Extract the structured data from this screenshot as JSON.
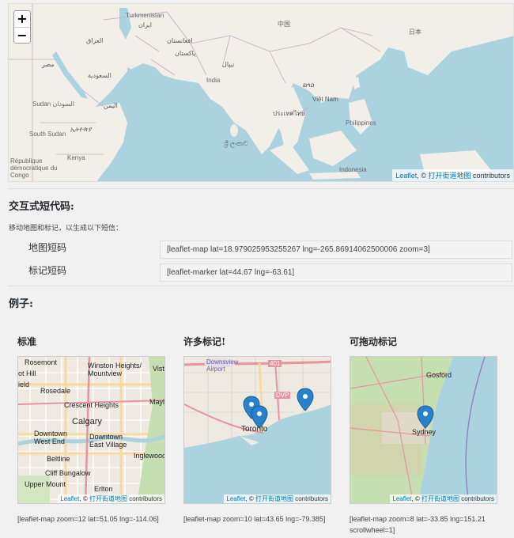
{
  "map": {
    "zoom_in": "+",
    "zoom_out": "−",
    "attribution_leaflet": "Leaflet",
    "attribution_sep": ", © ",
    "attribution_osm": "打开街道地图",
    "attribution_contrib": " contributors",
    "labels": [
      "Turkmenistan",
      "中国",
      "日本",
      "العراق",
      "افغانستان",
      "پاکستان",
      "مصر",
      "السعودية",
      "India",
      "Sudan السودان",
      "اليمن",
      "ประเทศไทย",
      "Philippines",
      "South Sudan",
      "ኢትዮጵያ",
      "Kenya",
      "République démocratique du Congo",
      "Indonesia",
      "ایران",
      "ລາວ",
      "Việt Nam",
      "نیپال",
      "ශ්‍රී ලංකාව"
    ]
  },
  "interactive": {
    "heading": "交互式短代码:",
    "hint": "移动地图和标记，以生成以下短信：",
    "map_label": "地图短码",
    "map_code": "[leaflet-map lat=18.979025953255267 lng=-265.86914062500006 zoom=3]",
    "marker_label": "标记短码",
    "marker_code": "[leaflet-marker lat=44.67 lng=-63.61]"
  },
  "examples": {
    "heading": "例子:",
    "items": [
      {
        "title": "标准",
        "code": "[leaflet-map zoom=12 lat=51.05 lng=-114.06]",
        "labels": [
          "Rosemont",
          "Winston Heights/ Mountview",
          "ot Hill",
          "ield",
          "Rosedale",
          "Crescent Heights",
          "Mayla",
          "Calgary",
          "Downtown West End",
          "Downtown East Village",
          "Beltline",
          "Inglewood",
          "Cliff Bungalow",
          "Upper Mount",
          "Erlton",
          "Vista"
        ]
      },
      {
        "title": "许多标记!",
        "code": "[leaflet-map zoom=10 lat=43.65 lng=-79.385]",
        "labels": [
          "Downsview Airport",
          "401",
          "DVP",
          "Toronto"
        ]
      },
      {
        "title": "可拖动标记",
        "code": "[leaflet-map zoom=8 lat=-33.85 lng=151.21 scrollwheel=1]",
        "labels": [
          "Gosford",
          "Sydney"
        ]
      }
    ]
  }
}
